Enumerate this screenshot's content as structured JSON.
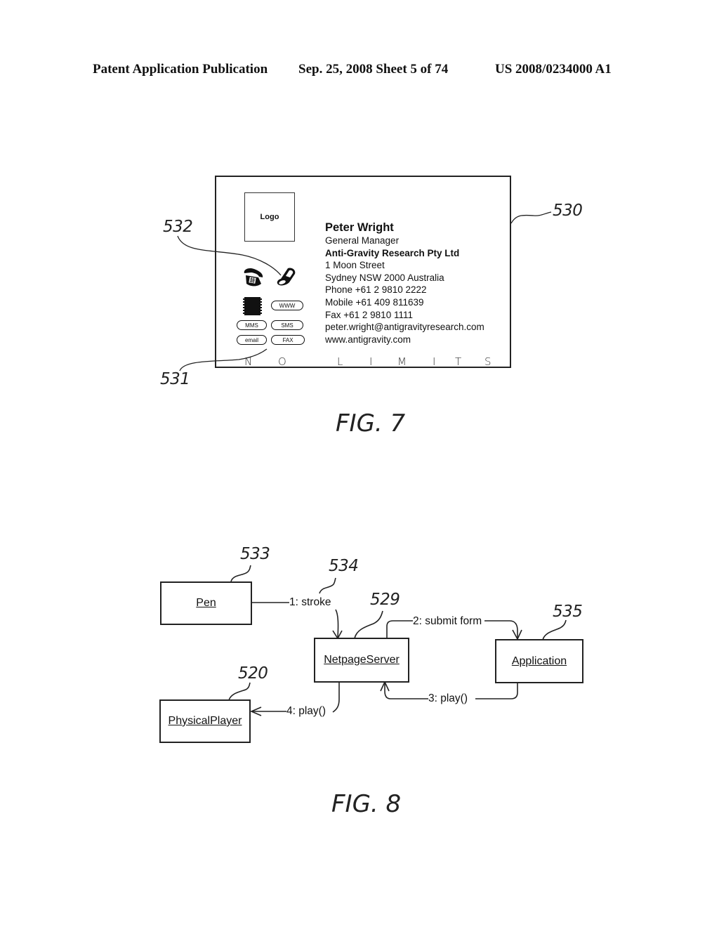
{
  "header": {
    "publication": "Patent Application Publication",
    "date_sheet": "Sep. 25, 2008   Sheet 5 of 74",
    "patent_number": "US 2008/0234000 A1"
  },
  "fig7": {
    "caption": "FIG. 7",
    "refs": {
      "card": "530",
      "phone_icon": "532",
      "buttons": "531"
    },
    "card": {
      "logo_label": "Logo",
      "name": "Peter Wright",
      "title": "General Manager",
      "company": "Anti-Gravity Research Pty Ltd",
      "address1": "1 Moon Street",
      "address2": "Sydney NSW 2000 Australia",
      "phone": "Phone +61 2 9810 2222",
      "mobile": "Mobile +61 409 811639",
      "fax": "Fax +61 2 9810 1111",
      "email": "peter.wright@antigravityresearch.com",
      "website": "www.antigravity.com",
      "icons": [
        "desk-phone-icon",
        "mobile-phone-icon",
        "barcode-icon"
      ],
      "buttons": [
        "WWW",
        "MMS",
        "SMS",
        "email",
        "FAX"
      ],
      "tagline_letters": [
        "N",
        "O",
        "L",
        "I",
        "M",
        "I",
        "T",
        "S"
      ]
    }
  },
  "fig8": {
    "caption": "FIG. 8",
    "objects": {
      "pen": {
        "label": "Pen",
        "ref": "533"
      },
      "server": {
        "label": "NetpageServer",
        "ref": "529"
      },
      "application": {
        "label": "Application",
        "ref": "535"
      },
      "player": {
        "label": "PhysicalPlayer",
        "ref": "520"
      }
    },
    "messages": {
      "stroke": "1: stroke",
      "stroke_ref": "534",
      "submit": "2: submit form",
      "play3": "3: play()",
      "play4": "4: play()"
    }
  }
}
